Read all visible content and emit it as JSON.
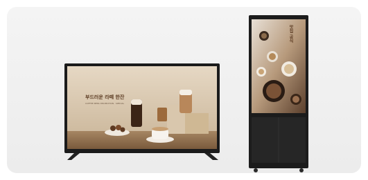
{
  "products": {
    "tv": {
      "headline": "부드러운 라떼 한잔",
      "subline": "COFFEE MENU PROMOTION ·  SPECIAL"
    },
    "kiosk": {
      "headline": "맛집 공식"
    }
  },
  "colors": {
    "card_bg": "#efefef",
    "bezel": "#1a1a1a",
    "tv_screen_bg": "#d8c6b0",
    "kiosk_screen_bg": "#7a5a44",
    "headline_color": "#5b3b22"
  }
}
